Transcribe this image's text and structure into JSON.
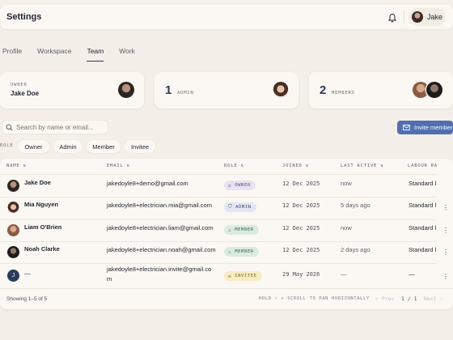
{
  "header": {
    "title": "Settings",
    "user_name": "Jake"
  },
  "tabs": [
    "Profile",
    "Workspace",
    "Team",
    "Work"
  ],
  "active_tab": "Team",
  "stats": {
    "owner": {
      "label": "OWNER",
      "name": "Jake Doe"
    },
    "admin": {
      "count": "1",
      "label": "ADMIN"
    },
    "members": {
      "count": "2",
      "label": "MEMBERS"
    }
  },
  "search": {
    "placeholder": "Search by name or email..."
  },
  "invite_button": "Invite member",
  "filters": {
    "label": "ROLE",
    "chips": [
      "Owner",
      "Admin",
      "Member",
      "Invitee"
    ]
  },
  "table": {
    "columns": [
      "NAME",
      "EMAIL",
      "ROLE",
      "JOINED",
      "LAST ACTIVE",
      "LABOUR RA"
    ],
    "rows": [
      {
        "name": "Jake Doe",
        "email": "jakedoyle8+demo@gmail.com",
        "email2": "",
        "role": "OWNER",
        "joined": "12 Dec 2025",
        "last_active": "now",
        "labour": "Standard l"
      },
      {
        "name": "Mia Nguyen",
        "email": "jakedoyle8+electrician.mia@gmail.com",
        "email2": "",
        "role": "ADMIN",
        "joined": "12 Dec 2025",
        "last_active": "5 days ago",
        "labour": "Standard l"
      },
      {
        "name": "Liam O'Brien",
        "email": "jakedoyle8+electrician.liam@gmail.com",
        "email2": "",
        "role": "MEMBER",
        "joined": "12 Dec 2025",
        "last_active": "now",
        "labour": "Standard l"
      },
      {
        "name": "Noah Clarke",
        "email": "jakedoyle8+electrician.noah@gmail.com",
        "email2": "",
        "role": "MEMBER",
        "joined": "12 Dec 2025",
        "last_active": "2 days ago",
        "labour": "Standard l"
      },
      {
        "name": "—",
        "email": "jakedoyle8+electrician.invite@gmail.co",
        "email2": "m",
        "role": "INVITEE",
        "joined": "29 May 2026",
        "last_active": "—",
        "labour": "—",
        "initial": "J"
      }
    ],
    "footer": {
      "showing": "Showing 1–5 of 5",
      "hint": "HOLD ⇧ + SCROLL TO PAN HORIZONTALLY",
      "prev": "‹ Prev",
      "page": "1 / 1",
      "next": "Next ›"
    }
  },
  "colors": {
    "accent": "#4f6fb0",
    "owner_badge": "#e9e2f2",
    "admin_badge": "#e2e6f2",
    "member_badge": "#dcebdf",
    "invitee_badge": "#f7ecc4"
  }
}
